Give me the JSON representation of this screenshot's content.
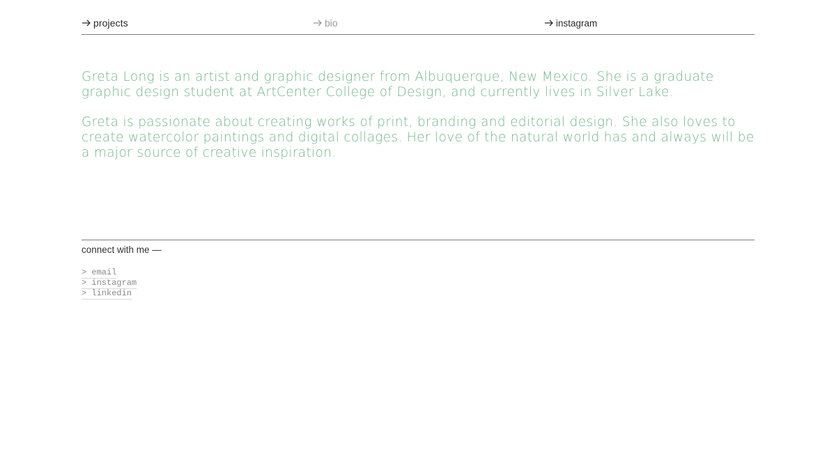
{
  "nav": {
    "items": [
      {
        "label": "projects",
        "icon": "arrow-right-icon",
        "active": true
      },
      {
        "label": "bio",
        "icon": "arrow-right-icon",
        "active": false
      },
      {
        "label": "instagram",
        "icon": "arrow-right-icon",
        "active": true
      }
    ]
  },
  "bio": {
    "paragraphs": [
      "Greta Long is an artist and graphic designer from Albuquerque, New Mexico. She is a graduate graphic design student at ArtCenter College of Design, and currently lives in Silver Lake.",
      "Greta is passionate about creating works of print, branding and editorial design. She also loves to create watercolor paintings and digital collages. Her love of the natural world has and always will be a major source of creative inspiration."
    ]
  },
  "footer": {
    "heading": "connect with me —",
    "links": [
      {
        "prefix": ">",
        "label": "email"
      },
      {
        "prefix": ">",
        "label": "instagram"
      },
      {
        "prefix": ">",
        "label": "linkedin"
      }
    ]
  },
  "colors": {
    "accent_green": "#72b68a",
    "text_dark": "#2a2a2a",
    "text_dim": "#9b9b9b",
    "rule": "#7d7d7d"
  }
}
